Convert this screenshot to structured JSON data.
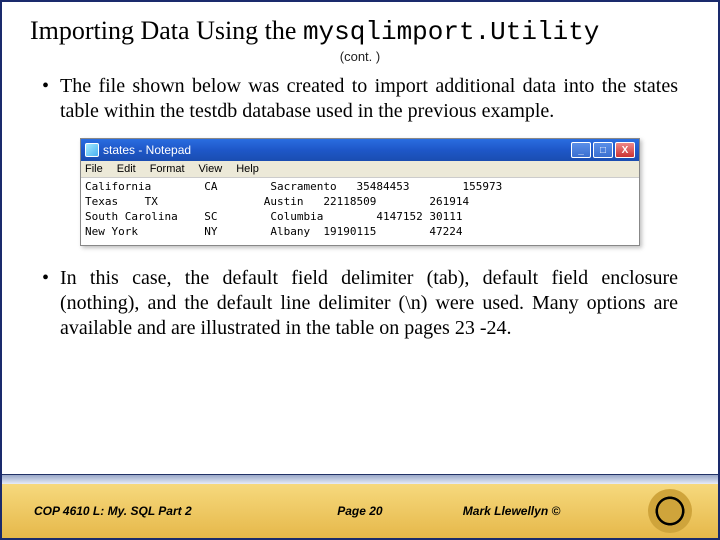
{
  "title_pre": "Importing Data Using the ",
  "title_mono": "mysqlimport.Utility",
  "cont": "(cont. )",
  "bullet1": "The file shown below was created to import additional data into the states table within the testdb database used in the previous example.",
  "bullet2": "In this case, the default field delimiter (tab), default field enclosure (nothing), and the default line delimiter (\\n) were used.  Many options are available and are illustrated in the table on pages 23 -24.",
  "notepad": {
    "title": "states - Notepad",
    "menu": [
      "File",
      "Edit",
      "Format",
      "View",
      "Help"
    ],
    "content": "California        CA        Sacramento   35484453        155973\nTexas    TX                Austin   22118509        261914\nSouth Carolina    SC        Columbia        4147152 30111\nNew York          NY        Albany  19190115        47224"
  },
  "footer": {
    "course": "COP 4610 L: My. SQL Part 2",
    "page": "Page 20",
    "author": "Mark Llewellyn ©"
  }
}
